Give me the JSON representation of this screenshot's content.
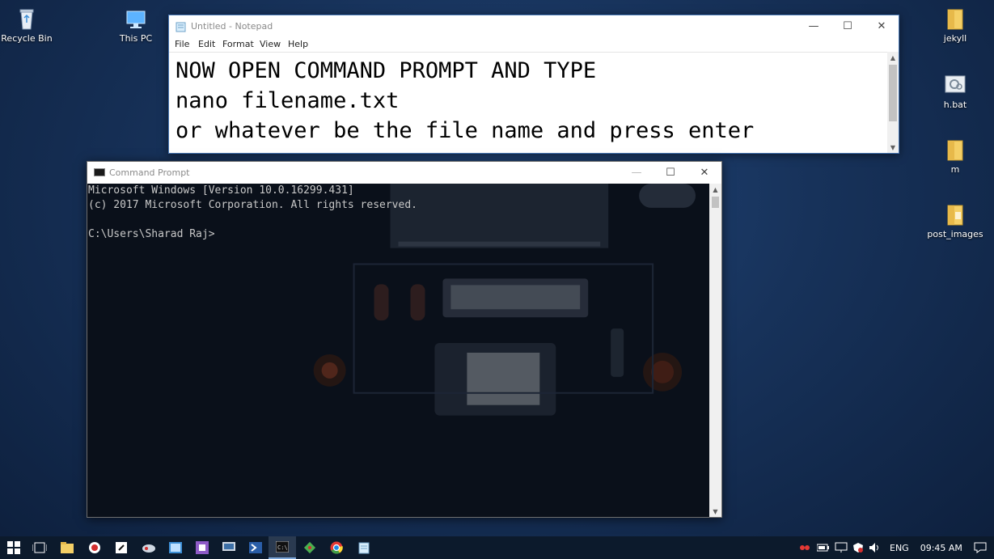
{
  "desktop": {
    "icons_left": [
      {
        "label": "Recycle Bin",
        "icon": "recycle-bin-icon"
      },
      {
        "label": "This PC",
        "icon": "computer-icon"
      }
    ],
    "icons_right": [
      {
        "label": "jekyll",
        "icon": "folder-icon"
      },
      {
        "label": "h.bat",
        "icon": "batch-file-icon"
      },
      {
        "label": "m",
        "icon": "folder-icon"
      },
      {
        "label": "post_images",
        "icon": "folder-icon"
      }
    ]
  },
  "notepad": {
    "title": "Untitled - Notepad",
    "menu": [
      "File",
      "Edit",
      "Format",
      "View",
      "Help"
    ],
    "lines": [
      "NOW OPEN COMMAND PROMPT AND TYPE",
      "nano filename.txt",
      "or whatever be the file name and press enter"
    ]
  },
  "cmd": {
    "title": "Command Prompt",
    "lines": [
      "Microsoft Windows [Version 10.0.16299.431]",
      "(c) 2017 Microsoft Corporation. All rights reserved.",
      "",
      "C:\\Users\\Sharad Raj>"
    ]
  },
  "window_controls": {
    "minimize": "—",
    "maximize": "☐",
    "close": "✕"
  },
  "taskbar": {
    "apps": [
      "start-icon",
      "task-view-icon",
      "file-explorer-icon",
      "record-app-icon",
      "sticky-app-icon",
      "cloud-app-icon",
      "photos-app-icon",
      "visual-studio-icon",
      "remote-desktop-icon",
      "powershell-icon",
      "command-prompt-icon",
      "git-icon",
      "chrome-icon",
      "notepad-icon"
    ],
    "active_app": "command-prompt-icon",
    "tray": {
      "language": "ENG",
      "time": "09:45 AM"
    }
  },
  "colors": {
    "desktop_bg": "#17325a",
    "taskbar_bg": "#0c1a2c",
    "console_bg": "#0a0e16",
    "console_text": "#c8c8c8"
  }
}
